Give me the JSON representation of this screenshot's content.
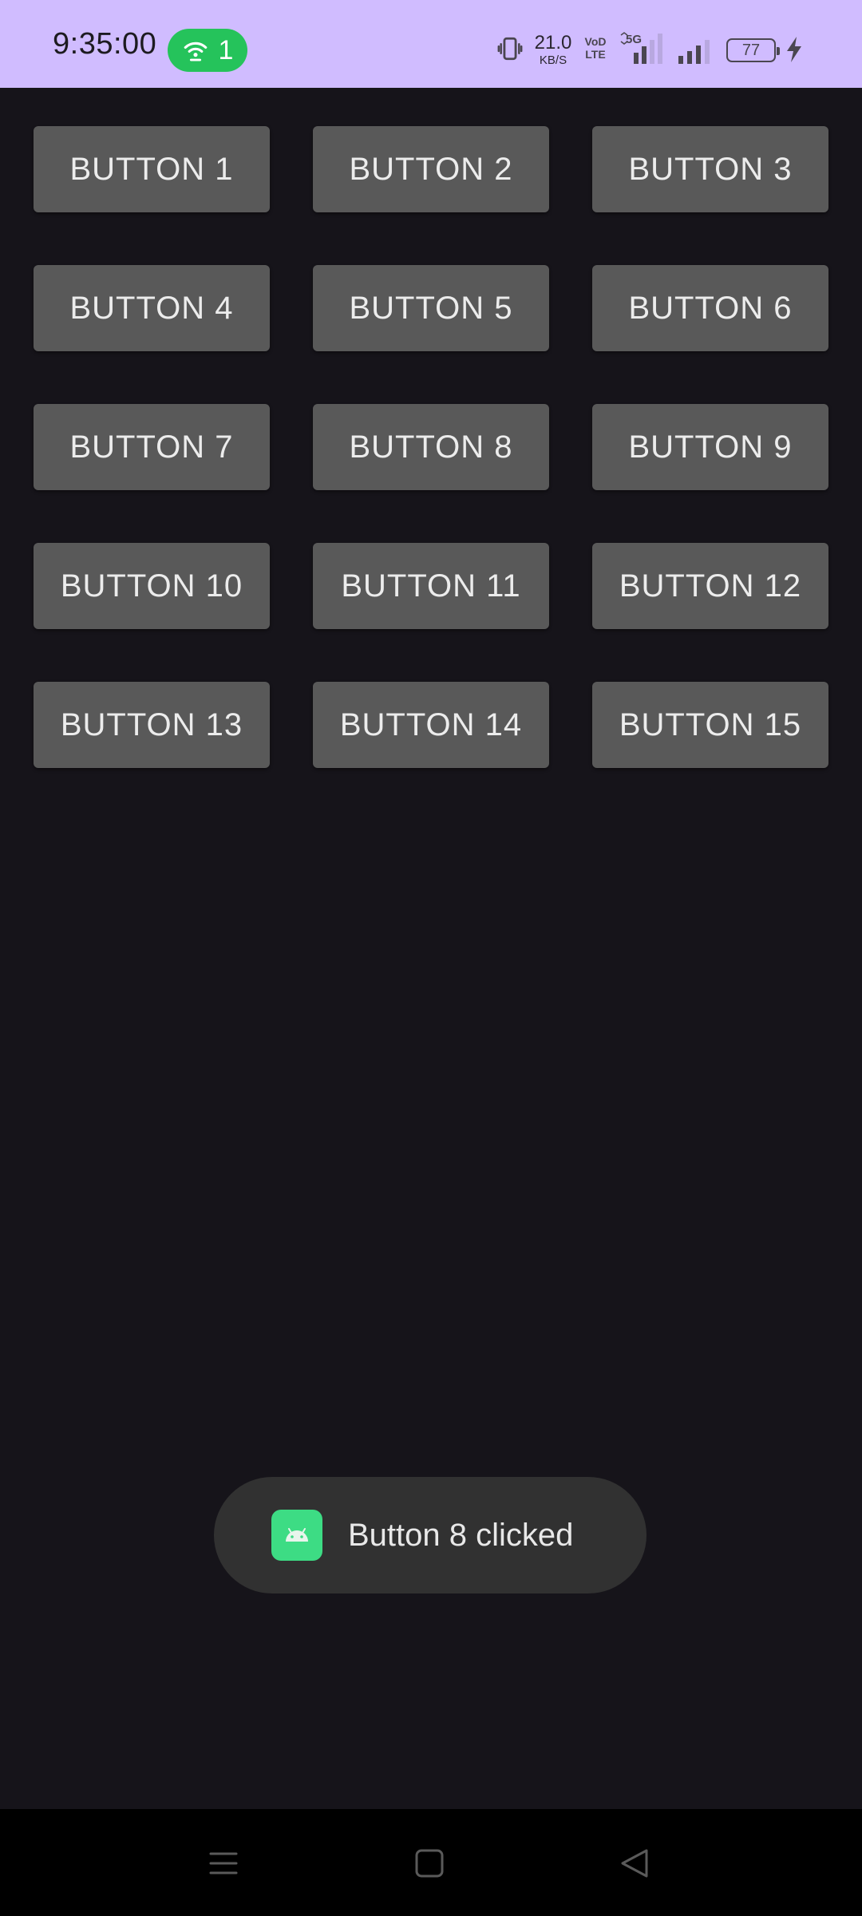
{
  "status_bar": {
    "time": "9:35:00",
    "hotspot_count": "1",
    "net_speed_value": "21.0",
    "net_speed_unit": "KB/S",
    "volte_top": "VoD",
    "volte_bottom": "LTE",
    "network_type": "5G",
    "battery_level": "77",
    "icons": [
      "hotspot-icon",
      "vibrate-icon",
      "signal-icon",
      "battery-icon",
      "charging-icon"
    ]
  },
  "buttons": [
    "BUTTON 1",
    "BUTTON 2",
    "BUTTON 3",
    "BUTTON 4",
    "BUTTON 5",
    "BUTTON 6",
    "BUTTON 7",
    "BUTTON 8",
    "BUTTON 9",
    "BUTTON 10",
    "BUTTON 11",
    "BUTTON 12",
    "BUTTON 13",
    "BUTTON 14",
    "BUTTON 15"
  ],
  "toast": {
    "message": "Button 8 clicked",
    "icon": "android-icon"
  },
  "nav_bar": {
    "icons": [
      "recents-icon",
      "home-icon",
      "back-icon"
    ]
  },
  "colors": {
    "status_bar_bg": "#d0bcff",
    "background": "#16141a",
    "button_bg": "#595959",
    "button_text": "#ececec",
    "hotspot_pill": "#25c35b",
    "toast_bg": "#313131",
    "android_green": "#3ddc84"
  }
}
